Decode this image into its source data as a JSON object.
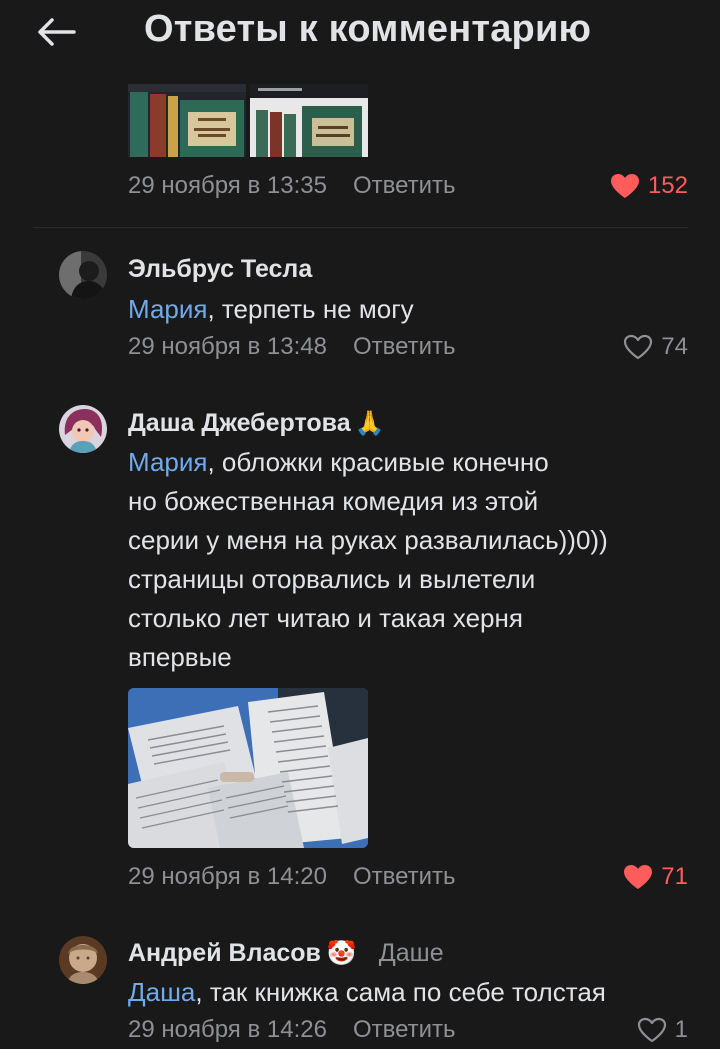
{
  "header": {
    "title": "Ответы к комментарию"
  },
  "colors": {
    "background": "#19191a",
    "text": "#e1e3e6",
    "secondary": "#8e9094",
    "mention": "#71aaeb",
    "like_active": "#ff5c5c"
  },
  "top_comment": {
    "date": "29 ноября в 13:35",
    "reply_label": "Ответить",
    "likes": "152",
    "liked": true
  },
  "comments": [
    {
      "author": "Эльбрус Тесла",
      "mention": "Мария",
      "text": ", терпеть не могу",
      "date": "29 ноября в 13:48",
      "reply_label": "Ответить",
      "likes": "74",
      "liked": false
    },
    {
      "author": "Даша Джебертова",
      "author_emoji": "🙏",
      "mention": "Мария",
      "text": ", обложки красивые конечно\nно божественная комедия из этой\nсерии у меня на руках развалилась))0))\nстраницы оторвались и вылетели\nстолько лет читаю и такая херня\nвпервые",
      "date": "29 ноября в 14:20",
      "reply_label": "Ответить",
      "likes": "71",
      "liked": true
    },
    {
      "author": "Андрей Власов",
      "author_emoji": "🤡",
      "reply_to": "Даше",
      "mention": "Даша",
      "text": ", так книжка сама по себе толстая",
      "date": "29 ноября в 14:26",
      "reply_label": "Ответить",
      "likes": "1",
      "liked": false
    }
  ]
}
